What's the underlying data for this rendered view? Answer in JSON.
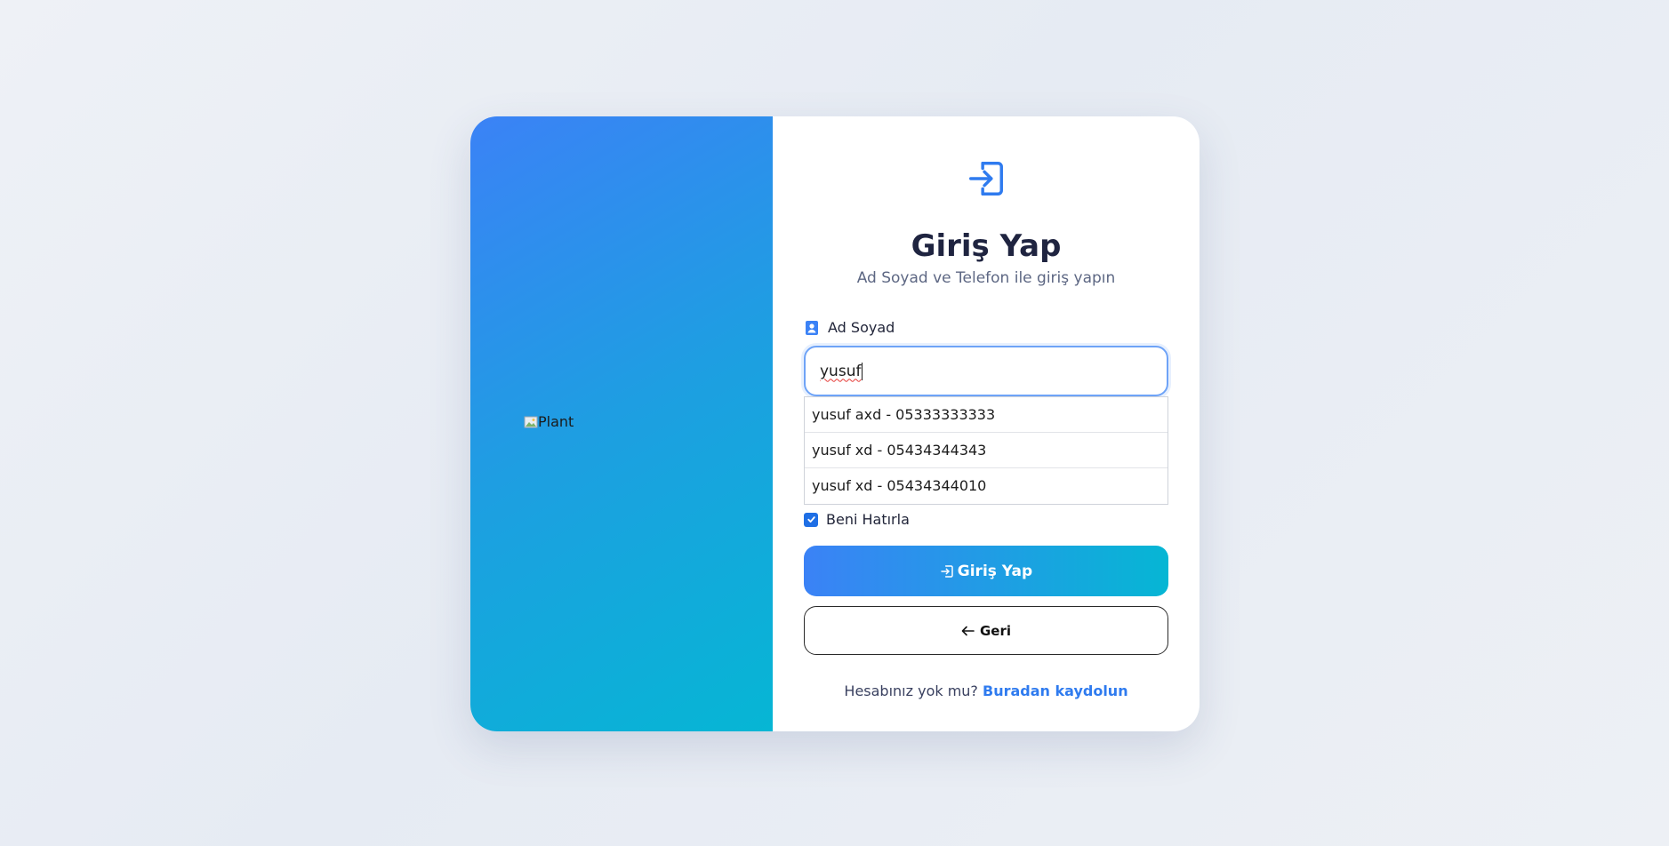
{
  "left_panel": {
    "image_alt": "Plant"
  },
  "header": {
    "icon": "login-icon",
    "title": "Giriş Yap",
    "subtitle": "Ad Soyad ve Telefon ile giriş yapın"
  },
  "form": {
    "name_label": "Ad Soyad",
    "name_label_icon": "contact-card-icon",
    "name_value": "yusuf",
    "suggestions": [
      "yusuf axd - 05333333333",
      "yusuf xd - 05434344343",
      "yusuf xd - 05434344010"
    ],
    "remember_label": "Beni Hatırla",
    "remember_checked": true,
    "submit_label": "Giriş Yap",
    "back_label": "Geri"
  },
  "footer": {
    "prompt": "Hesabınız yok mu?",
    "link": "Buradan kaydolun"
  },
  "colors": {
    "accent": "#3b82f6",
    "gradient_end": "#06b6d4",
    "title": "#1f2440",
    "link": "#2f7bef"
  }
}
